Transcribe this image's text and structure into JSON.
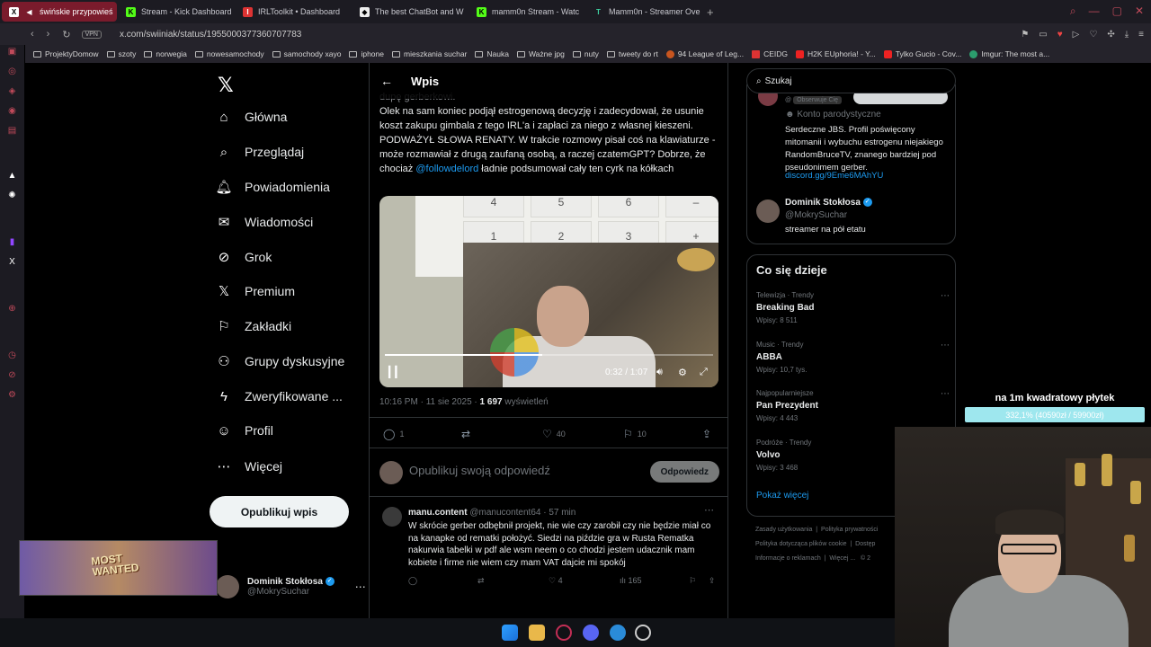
{
  "browser": {
    "tabs": [
      {
        "label": "świńskie przypowieś",
        "active": true,
        "icon": "x-logo-icon"
      },
      {
        "label": "Stream - Kick Dashboard",
        "active": false,
        "icon": "kick-icon"
      },
      {
        "label": "IRLToolkit • Dashboard",
        "active": false,
        "icon": "irltoolkit-icon"
      },
      {
        "label": "The best ChatBot and W",
        "active": false,
        "icon": "chatbot-icon"
      },
      {
        "label": "mamm0n Stream - Watc",
        "active": false,
        "icon": "kick-icon"
      },
      {
        "label": "Mamm0n - Streamer Ove",
        "active": false,
        "icon": "streamer-icon"
      }
    ],
    "new_tab": "+",
    "vpn": "VPN",
    "url": "x.com/swiiniak/status/1955000377360707783",
    "bookmarks": [
      "ProjektyDomow",
      "szoty",
      "norwegia",
      "nowesamochody",
      "samochody xayo",
      "iphone",
      "mieszkania suchar",
      "Nauka",
      "Ważne jpg",
      "nuty",
      "tweety do rt",
      "94 League of Leg...",
      "CEIDG",
      "H2K EUphoria! - Y...",
      "Tylko Gucio - Cov...",
      "Imgur: The most a..."
    ]
  },
  "nav": {
    "items": [
      {
        "label": "Główna",
        "icon": "home-icon"
      },
      {
        "label": "Przeglądaj",
        "icon": "search-icon"
      },
      {
        "label": "Powiadomienia",
        "icon": "bell-icon"
      },
      {
        "label": "Wiadomości",
        "icon": "mail-icon"
      },
      {
        "label": "Grok",
        "icon": "grok-icon"
      },
      {
        "label": "Premium",
        "icon": "x-logo-icon"
      },
      {
        "label": "Zakładki",
        "icon": "bookmark-icon"
      },
      {
        "label": "Grupy dyskusyjne",
        "icon": "communities-icon"
      },
      {
        "label": "Zweryfikowane ...",
        "icon": "lightning-icon"
      },
      {
        "label": "Profil",
        "icon": "profile-icon"
      },
      {
        "label": "Więcej",
        "icon": "more-circle-icon"
      }
    ],
    "post_button": "Opublikuj wpis",
    "account": {
      "name": "Dominik Stokłosa",
      "handle": "@MokrySuchar"
    }
  },
  "main": {
    "title": "Wpis",
    "tweet": {
      "partial_line": "dupę gerberkowi.",
      "text_before_mention": "Olek na sam koniec podjął estrogenową decyzję i zadecydował, że usunie koszt zakupu gimbala z tego IRL'a i zapłaci za niego z własnej kieszeni. PODWAŻYŁ SŁOWA RENATY. W trakcie rozmowy pisał coś na klawiaturze - może rozmawiał z drugą zaufaną osobą, a raczej czatemGPT? Dobrze, że chociaż",
      "mention": "@followdelord",
      "text_after_mention": " ładnie podsumował cały ten cyrk na kółkach"
    },
    "video": {
      "keys": [
        "4",
        "5",
        "6",
        "–",
        "1",
        "2",
        "3",
        "+"
      ],
      "time": "0:32 / 1:07",
      "progress": 0.48
    },
    "meta": {
      "time": "10:16 PM · 11 sie 2025 · ",
      "views": "1 697",
      "views_label": " wyświetleń"
    },
    "actions": {
      "replies": "1",
      "retweets": "",
      "likes": "40",
      "bookmarks": "10"
    },
    "reply_placeholder": "Opublikuj swoją odpowiedź",
    "reply_button": "Odpowiedz",
    "reply": {
      "name": "manu.content",
      "handle": "@manucontent64 · 57 min",
      "text": "W skrócie gerber odbębnił projekt, nie wie czy zarobił czy nie będzie miał co na kanapke od rematki położyć. Siedzi na piździe gra w Rusta Rematka nakurwia tabelki w pdf ale wsm neem o co chodzi jestem udacznik mam kobiete i firme nie wiem czy mam VAT dajcie mi spokój",
      "likes": "4",
      "views": "165"
    }
  },
  "right": {
    "search_placeholder": "Szukaj",
    "profile_card": {
      "badge": "Obserwuje Cię",
      "parody": "Konto parodystyczne",
      "bio": "Serdeczne JBS. Profil poświęcony mitomanii i wybuchu estrogenu niejakiego RandomBruceTV, znanego bardziej pod pseudonimem gerber.",
      "link": "discord.gg/9Eme6MAhYU",
      "user_name": "Dominik Stokłosa",
      "user_handle": "@MokrySuchar",
      "user_desc": "streamer na pół etatu"
    },
    "trends_title": "Co się dzieje",
    "trends": [
      {
        "category": "Telewizja · Trendy",
        "name": "Breaking Bad",
        "count": "Wpisy: 8 511"
      },
      {
        "category": "Music · Trendy",
        "name": "ABBA",
        "count": "Wpisy: 10,7 tys."
      },
      {
        "category": "Najpopularniejsze",
        "name": "Pan Prezydent",
        "count": "Wpisy: 4 443"
      },
      {
        "category": "Podróże · Trendy",
        "name": "Volvo",
        "count": "Wpisy: 3 468"
      }
    ],
    "show_more": "Pokaż więcej",
    "footer": [
      "Zasady użytkowania",
      "Polityka prywatności",
      "Polityka dotycząca plików cookie",
      "Dostęp",
      "Informacje o reklamach",
      "Więcej ...",
      "© 2"
    ]
  },
  "stream": {
    "goal_title": "na 1m kwadratowy płytek",
    "goal_progress": "332,1% (40590zł / 59900zł)",
    "game_text_1": "MOST",
    "game_text_2": "WANTED"
  },
  "colors": {
    "accent": "#1d9bf0",
    "tab_active": "#7a1b2c",
    "goal_bar": "#9ee7ee"
  }
}
